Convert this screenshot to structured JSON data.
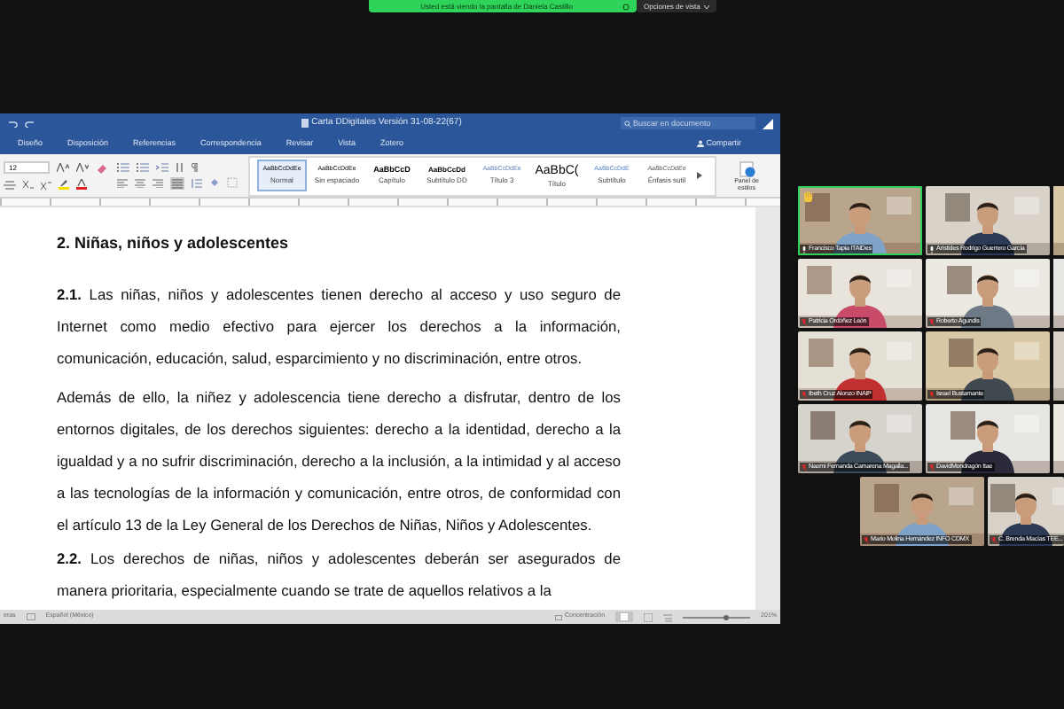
{
  "share_banner": {
    "text": "Usted está viendo la pantalla de Daniela Castillo",
    "view_options": "Opciones de vista"
  },
  "word": {
    "title": "Carta DDigitales Versión 31-08-22(67)",
    "search_placeholder": "Buscar en documento",
    "share": "Compartir",
    "tabs": [
      {
        "label": "Diseño",
        "selected": false
      },
      {
        "label": "Disposición",
        "selected": false
      },
      {
        "label": "Referencias",
        "selected": false
      },
      {
        "label": "Correspondencia",
        "selected": false
      },
      {
        "label": "Revisar",
        "selected": false
      },
      {
        "label": "Vista",
        "selected": false
      },
      {
        "label": "Zotero",
        "selected": false
      }
    ],
    "font_size": "12",
    "styles": [
      {
        "preview": "AaBbCcDdEe",
        "label": "Normal",
        "selected": true
      },
      {
        "preview": "AaBbCcDdEe",
        "label": "Sin espaciado",
        "selected": false
      },
      {
        "preview": "AaBbCcD",
        "label": "Capítulo",
        "selected": false
      },
      {
        "preview": "AaBbCcDd",
        "label": "Subtítulo DD",
        "selected": false
      },
      {
        "preview": "AaBbCcDdEe",
        "label": "Título 3",
        "selected": false
      },
      {
        "preview": "AaBbC(",
        "label": "Título",
        "selected": false
      },
      {
        "preview": "AaBbCcDdE",
        "label": "Subtítulo",
        "selected": false
      },
      {
        "preview": "AaBbCcDdEe",
        "label": "Énfasis sutil",
        "selected": false
      }
    ],
    "styles_pane": "Panel de estilos",
    "document": [
      {
        "kind": "heading",
        "text": "2. Niñas, niños y adolescentes"
      },
      {
        "kind": "paragraph",
        "text": "**2.1.** Las niñas, niños y adolescentes tienen derecho al acceso y uso seguro de Internet como medio efectivo para ejercer los derechos a la información, comunicación, educación, salud, esparcimiento y no discriminación, entre otros."
      },
      {
        "kind": "paragraph",
        "text": "Además de ello, la niñez y adolescencia tiene derecho a disfrutar, dentro de los entornos digitales, de los derechos siguientes: derecho a la identidad, derecho a la igualdad y a no sufrir discriminación, derecho a la inclusión, a la intimidad y al acceso a las tecnologías de la información y comunicación, entre otros, de conformidad con el artículo 13 de la Ley General de los Derechos de Niñas, Niños y Adolescentes."
      },
      {
        "kind": "paragraph",
        "text": "**2.2.** Los derechos de niñas, niños y adolescentes deberán ser asegurados de manera prioritaria, especialmente cuando se trate de aquellos relativos a la"
      }
    ],
    "status": {
      "words": "eras",
      "language": "Español (México)",
      "focus": "Concentración",
      "zoom": "201%",
      "zoom_slider": {
        "level": 0.65
      }
    }
  },
  "participants": [
    {
      "kind": "tile",
      "name": "Francisco Tapia ITAIDes",
      "muted": false,
      "speaking": true,
      "hand_raised": true
    },
    {
      "kind": "tile",
      "name": "Arístides Rodrigo Guerrero García",
      "muted": false,
      "speaking": false,
      "hand_raised": false
    },
    {
      "kind": "cut"
    },
    {
      "kind": "tile",
      "name": "Patricia Ordóñez León",
      "muted": true,
      "speaking": false,
      "hand_raised": false
    },
    {
      "kind": "tile",
      "name": "Roberto Agundis",
      "muted": true,
      "speaking": false,
      "hand_raised": false
    },
    {
      "kind": "cut"
    },
    {
      "kind": "tile",
      "name": "Ibeth Cruz Alonzo INAIP",
      "muted": true,
      "speaking": false,
      "hand_raised": false
    },
    {
      "kind": "tile",
      "name": "Israel Bustamante",
      "muted": true,
      "speaking": false,
      "hand_raised": false
    },
    {
      "kind": "cut"
    },
    {
      "kind": "tile",
      "name": "Naomi Fernanda Camarena Magalla...",
      "muted": true,
      "speaking": false,
      "hand_raised": false
    },
    {
      "kind": "tile",
      "name": "DavidMondragón Itae",
      "muted": true,
      "speaking": false,
      "hand_raised": false
    },
    {
      "kind": "cut"
    }
  ],
  "participants_last_row": [
    {
      "kind": "tile",
      "name": "Mario Molina Hernández INFO CDMX",
      "muted": true,
      "speaking": false,
      "hand_raised": false
    },
    {
      "kind": "tile",
      "name": "C. Brenda Macías TEE...",
      "muted": true,
      "speaking": false,
      "hand_raised": false
    }
  ]
}
